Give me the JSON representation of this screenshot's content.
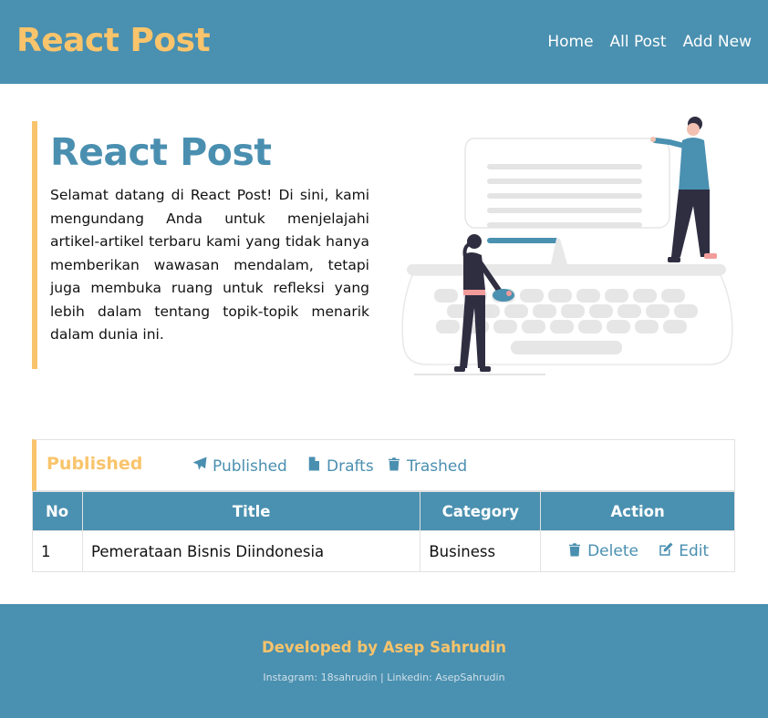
{
  "navbar": {
    "brand": "React Post",
    "links": [
      "Home",
      "All Post",
      "Add New"
    ]
  },
  "hero": {
    "title": "React Post",
    "text": "Selamat datang di React Post! Di sini, kami mengundang Anda untuk menjelajahi artikel-artikel terbaru kami yang tidak hanya memberikan wawasan mendalam, tetapi juga membuka ruang untuk refleksi yang lebih dalam tentang topik-topik menarik dalam dunia ini.",
    "illustration_icon": "typewriter-illustration"
  },
  "posts": {
    "section_title": "Published",
    "tabs": [
      {
        "label": "Published",
        "icon": "paper-plane-icon"
      },
      {
        "label": "Drafts",
        "icon": "file-icon"
      },
      {
        "label": "Trashed",
        "icon": "trash-icon"
      }
    ],
    "columns": [
      "No",
      "Title",
      "Category",
      "Action"
    ],
    "rows": [
      {
        "no": "1",
        "title": "Pemerataan Bisnis Diindonesia",
        "category": "Business",
        "delete_label": "Delete",
        "edit_label": "Edit"
      }
    ]
  },
  "footer": {
    "title": "Developed by Asep Sahrudin",
    "subtitle": "Instagram: 18sahrudin | Linkedin: AsepSahrudin"
  },
  "colors": {
    "primary": "#4a90b0",
    "accent": "#f9c46b",
    "text": "#111111"
  }
}
